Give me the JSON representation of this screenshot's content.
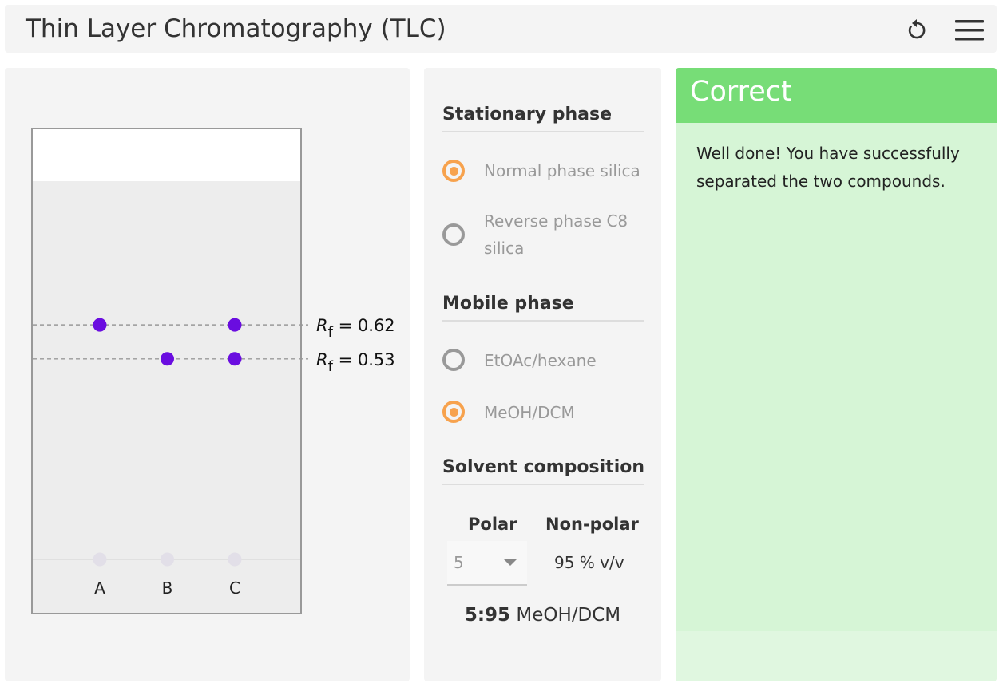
{
  "header": {
    "title": "Thin Layer Chromatography (TLC)",
    "reset_icon": "reset-icon",
    "menu_icon": "hamburger-menu-icon"
  },
  "plate": {
    "lanes": [
      "A",
      "B",
      "C"
    ],
    "rf_labels": [
      {
        "symbol": "R",
        "subscript": "f",
        "value": " = 0.62",
        "rf": 0.62
      },
      {
        "symbol": "R",
        "subscript": "f",
        "value": " = 0.53",
        "rf": 0.53
      }
    ],
    "spots": [
      {
        "lane": "A",
        "rf": 0.62
      },
      {
        "lane": "B",
        "rf": 0.53
      },
      {
        "lane": "C",
        "rf": 0.62
      },
      {
        "lane": "C",
        "rf": 0.53
      }
    ],
    "spot_color": "#6a0de0",
    "origin_spot_color": "#e2dfe8"
  },
  "controls": {
    "stationary_phase": {
      "heading": "Stationary phase",
      "options": [
        {
          "label": "Normal phase silica",
          "checked": true
        },
        {
          "label": "Reverse phase C8 silica",
          "checked": false
        }
      ]
    },
    "mobile_phase": {
      "heading": "Mobile phase",
      "options": [
        {
          "label": "EtOAc/hexane",
          "checked": false
        },
        {
          "label": "MeOH/DCM",
          "checked": true
        }
      ]
    },
    "solvent": {
      "heading": "Solvent composition",
      "polar_label": "Polar",
      "nonpolar_label": "Non-polar",
      "polar_value": "5",
      "nonpolar_value": "95 % v/v",
      "ratio": "5:95",
      "ratio_system": " MeOH/DCM"
    },
    "accent_color": "#f7a24d"
  },
  "feedback": {
    "title": "Correct",
    "message": "Well done! You have successfully separated the two compounds.",
    "header_color": "#77dd77",
    "body_color": "#d6f5d6"
  }
}
